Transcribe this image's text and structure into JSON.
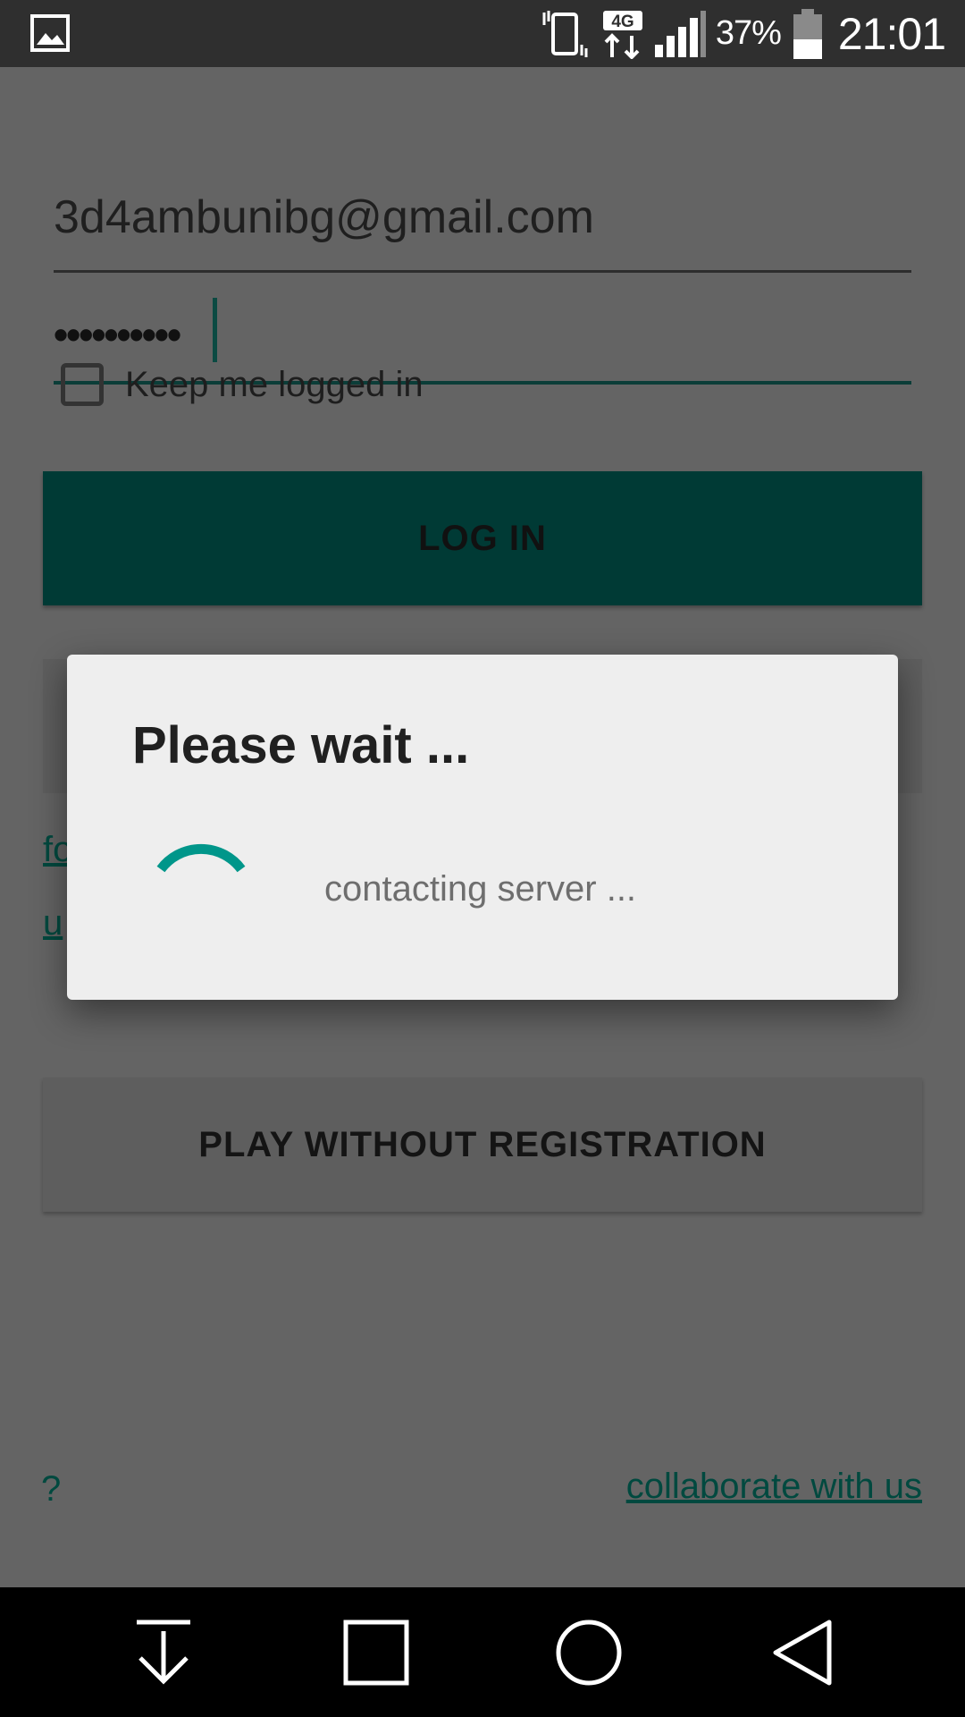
{
  "status_bar": {
    "battery_percent": "37%",
    "time": "21:01",
    "network": "4G",
    "icons": [
      "gallery-icon",
      "vibrate-icon",
      "network-4g-icon",
      "signal-icon",
      "battery-icon"
    ]
  },
  "login_form": {
    "email_value": "3d4ambunibg@gmail.com",
    "password_value": "••••••••••",
    "keep_logged_in_label": "Keep me logged in",
    "keep_logged_in_checked": false,
    "login_button_label": "LOG IN",
    "link_1_partial": "fo",
    "link_2_partial": "u"
  },
  "secondary": {
    "play_button_label": "PLAY WITHOUT REGISTRATION",
    "help_link": "?",
    "collaborate_link": "collaborate with us"
  },
  "dialog": {
    "title": "Please wait ...",
    "message": "contacting server ...",
    "spinner_color": "#00968a"
  },
  "nav_bar": {
    "icons": [
      "download-icon",
      "recents-icon",
      "home-icon",
      "back-icon"
    ]
  },
  "colors": {
    "accent": "#003a35",
    "link": "#00493f",
    "scrim_bg": "#646464"
  }
}
